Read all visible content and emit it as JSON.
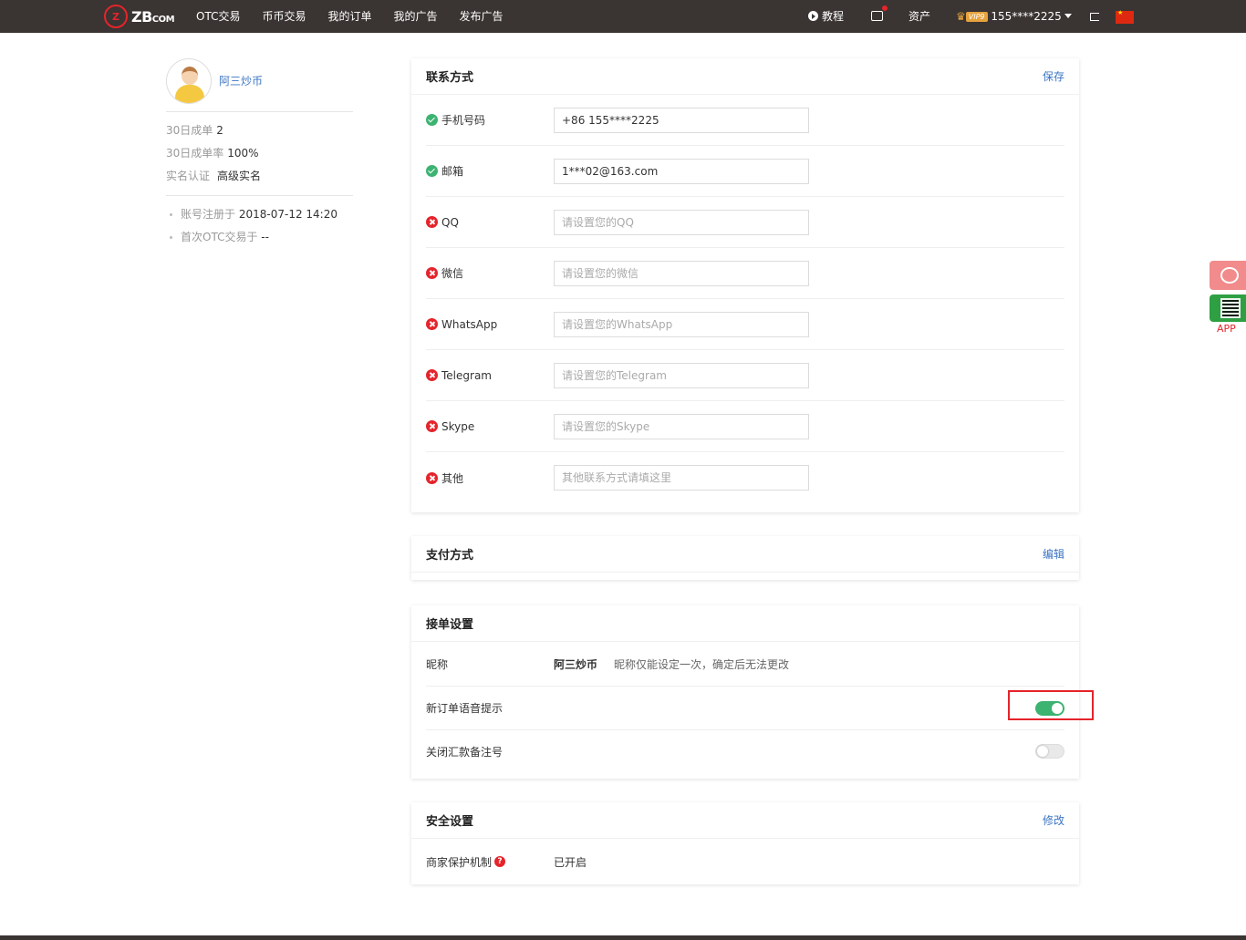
{
  "header": {
    "logo_mark": "Z",
    "logo_text": "ZB",
    "logo_suffix": "COM",
    "nav": [
      "OTC交易",
      "币币交易",
      "我的订单",
      "我的广告",
      "发布广告"
    ],
    "tutorial": "教程",
    "assets": "资产",
    "vip": "VIP9",
    "account": "155****2225"
  },
  "sidebar": {
    "username": "阿三炒币",
    "stats": [
      {
        "label": "30日成单",
        "value": "2"
      },
      {
        "label": "30日成单率",
        "value": "100%"
      },
      {
        "label": "实名认证",
        "value": "高级实名"
      }
    ],
    "notes": [
      {
        "label": "账号注册于",
        "value": "2018-07-12 14:20"
      },
      {
        "label": "首次OTC交易于",
        "value": "--"
      }
    ]
  },
  "contact": {
    "title": "联系方式",
    "action": "保存",
    "rows": [
      {
        "label": "手机号码",
        "verified": true,
        "value": "+86 155****2225",
        "placeholder": ""
      },
      {
        "label": "邮箱",
        "verified": true,
        "value": "1***02@163.com",
        "placeholder": ""
      },
      {
        "label": "QQ",
        "verified": false,
        "value": "",
        "placeholder": "请设置您的QQ"
      },
      {
        "label": "微信",
        "verified": false,
        "value": "",
        "placeholder": "请设置您的微信"
      },
      {
        "label": "WhatsApp",
        "verified": false,
        "value": "",
        "placeholder": "请设置您的WhatsApp"
      },
      {
        "label": "Telegram",
        "verified": false,
        "value": "",
        "placeholder": "请设置您的Telegram"
      },
      {
        "label": "Skype",
        "verified": false,
        "value": "",
        "placeholder": "请设置您的Skype"
      },
      {
        "label": "其他",
        "verified": false,
        "value": "",
        "placeholder": "其他联系方式请填这里"
      }
    ]
  },
  "payment": {
    "title": "支付方式",
    "action": "编辑"
  },
  "orders": {
    "title": "接单设置",
    "nickname_label": "昵称",
    "nickname_value": "阿三炒币",
    "nickname_hint": "昵称仅能设定一次，确定后无法更改",
    "voice_label": "新订单语音提示",
    "voice_on": true,
    "remark_label": "关闭汇款备注号",
    "remark_on": false
  },
  "security": {
    "title": "安全设置",
    "action": "修改",
    "label": "商家保护机制",
    "help": "?",
    "value": "已开启"
  },
  "floating": {
    "app_label": "APP"
  }
}
